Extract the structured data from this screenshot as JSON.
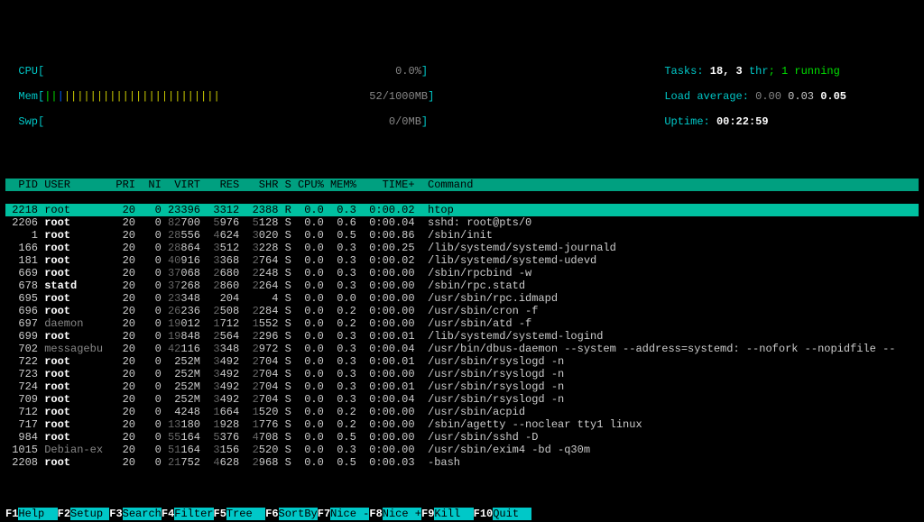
{
  "meters": {
    "cpu_label": "CPU",
    "mem_label": "Mem",
    "swp_label": "Swp",
    "cpu_value": "0.0%",
    "mem_value": "52/1000MB",
    "swp_value": "0/0MB",
    "tasks_label": "Tasks: ",
    "tasks_value": "18, 3 ",
    "tasks_thr": "thr",
    "tasks_running": "; 1 running",
    "load_label": "Load average: ",
    "load1": "0.00",
    "load2": "0.03",
    "load3": "0.05",
    "uptime_label": "Uptime: ",
    "uptime_value": "00:22:59"
  },
  "header": {
    "pid": "PID",
    "user": "USER",
    "pri": "PRI",
    "ni": "NI",
    "virt": "VIRT",
    "res": "RES",
    "shr": "SHR",
    "s": "S",
    "cpu": "CPU%",
    "mem": "MEM%",
    "time": "TIME+",
    "cmd": "Command"
  },
  "processes": [
    {
      "pid": "2218",
      "user": "root",
      "pri": "20",
      "ni": "0",
      "virt": "23396",
      "res": "3312",
      "shr": "2388",
      "s": "R",
      "cpu": "0.0",
      "mem": "0.3",
      "time": "0:00.02",
      "cmd": "htop",
      "selected": true
    },
    {
      "pid": "2206",
      "user": "root",
      "pri": "20",
      "ni": "0",
      "virt": "82700",
      "res": "5976",
      "shr": "5128",
      "s": "S",
      "cpu": "0.0",
      "mem": "0.6",
      "time": "0:00.04",
      "cmd": "sshd: root@pts/0"
    },
    {
      "pid": "1",
      "user": "root",
      "pri": "20",
      "ni": "0",
      "virt": "28556",
      "res": "4624",
      "shr": "3020",
      "s": "S",
      "cpu": "0.0",
      "mem": "0.5",
      "time": "0:00.86",
      "cmd": "/sbin/init"
    },
    {
      "pid": "166",
      "user": "root",
      "pri": "20",
      "ni": "0",
      "virt": "28864",
      "res": "3512",
      "shr": "3228",
      "s": "S",
      "cpu": "0.0",
      "mem": "0.3",
      "time": "0:00.25",
      "cmd": "/lib/systemd/systemd-journald"
    },
    {
      "pid": "181",
      "user": "root",
      "pri": "20",
      "ni": "0",
      "virt": "40916",
      "res": "3368",
      "shr": "2764",
      "s": "S",
      "cpu": "0.0",
      "mem": "0.3",
      "time": "0:00.02",
      "cmd": "/lib/systemd/systemd-udevd"
    },
    {
      "pid": "669",
      "user": "root",
      "pri": "20",
      "ni": "0",
      "virt": "37068",
      "res": "2680",
      "shr": "2248",
      "s": "S",
      "cpu": "0.0",
      "mem": "0.3",
      "time": "0:00.00",
      "cmd": "/sbin/rpcbind -w"
    },
    {
      "pid": "678",
      "user": "statd",
      "pri": "20",
      "ni": "0",
      "virt": "37268",
      "res": "2860",
      "shr": "2264",
      "s": "S",
      "cpu": "0.0",
      "mem": "0.3",
      "time": "0:00.00",
      "cmd": "/sbin/rpc.statd"
    },
    {
      "pid": "695",
      "user": "root",
      "pri": "20",
      "ni": "0",
      "virt": "23348",
      "res": "204",
      "shr": "4",
      "s": "S",
      "cpu": "0.0",
      "mem": "0.0",
      "time": "0:00.00",
      "cmd": "/usr/sbin/rpc.idmapd"
    },
    {
      "pid": "696",
      "user": "root",
      "pri": "20",
      "ni": "0",
      "virt": "26236",
      "res": "2508",
      "shr": "2284",
      "s": "S",
      "cpu": "0.0",
      "mem": "0.2",
      "time": "0:00.00",
      "cmd": "/usr/sbin/cron -f"
    },
    {
      "pid": "697",
      "user": "daemon",
      "pri": "20",
      "ni": "0",
      "virt": "19012",
      "res": "1712",
      "shr": "1552",
      "s": "S",
      "cpu": "0.0",
      "mem": "0.2",
      "time": "0:00.00",
      "cmd": "/usr/sbin/atd -f",
      "dim": true
    },
    {
      "pid": "699",
      "user": "root",
      "pri": "20",
      "ni": "0",
      "virt": "19848",
      "res": "2564",
      "shr": "2296",
      "s": "S",
      "cpu": "0.0",
      "mem": "0.3",
      "time": "0:00.01",
      "cmd": "/lib/systemd/systemd-logind"
    },
    {
      "pid": "702",
      "user": "messagebu",
      "pri": "20",
      "ni": "0",
      "virt": "42116",
      "res": "3348",
      "shr": "2972",
      "s": "S",
      "cpu": "0.0",
      "mem": "0.3",
      "time": "0:00.04",
      "cmd": "/usr/bin/dbus-daemon --system --address=systemd: --nofork --nopidfile --",
      "dim": true
    },
    {
      "pid": "722",
      "user": "root",
      "pri": "20",
      "ni": "0",
      "virt": "252M",
      "res": "3492",
      "shr": "2704",
      "s": "S",
      "cpu": "0.0",
      "mem": "0.3",
      "time": "0:00.01",
      "cmd": "/usr/sbin/rsyslogd -n"
    },
    {
      "pid": "723",
      "user": "root",
      "pri": "20",
      "ni": "0",
      "virt": "252M",
      "res": "3492",
      "shr": "2704",
      "s": "S",
      "cpu": "0.0",
      "mem": "0.3",
      "time": "0:00.00",
      "cmd": "/usr/sbin/rsyslogd -n"
    },
    {
      "pid": "724",
      "user": "root",
      "pri": "20",
      "ni": "0",
      "virt": "252M",
      "res": "3492",
      "shr": "2704",
      "s": "S",
      "cpu": "0.0",
      "mem": "0.3",
      "time": "0:00.01",
      "cmd": "/usr/sbin/rsyslogd -n"
    },
    {
      "pid": "709",
      "user": "root",
      "pri": "20",
      "ni": "0",
      "virt": "252M",
      "res": "3492",
      "shr": "2704",
      "s": "S",
      "cpu": "0.0",
      "mem": "0.3",
      "time": "0:00.04",
      "cmd": "/usr/sbin/rsyslogd -n"
    },
    {
      "pid": "712",
      "user": "root",
      "pri": "20",
      "ni": "0",
      "virt": "4248",
      "res": "1664",
      "shr": "1520",
      "s": "S",
      "cpu": "0.0",
      "mem": "0.2",
      "time": "0:00.00",
      "cmd": "/usr/sbin/acpid"
    },
    {
      "pid": "717",
      "user": "root",
      "pri": "20",
      "ni": "0",
      "virt": "13180",
      "res": "1928",
      "shr": "1776",
      "s": "S",
      "cpu": "0.0",
      "mem": "0.2",
      "time": "0:00.00",
      "cmd": "/sbin/agetty --noclear tty1 linux"
    },
    {
      "pid": "984",
      "user": "root",
      "pri": "20",
      "ni": "0",
      "virt": "55164",
      "res": "5376",
      "shr": "4708",
      "s": "S",
      "cpu": "0.0",
      "mem": "0.5",
      "time": "0:00.00",
      "cmd": "/usr/sbin/sshd -D"
    },
    {
      "pid": "1015",
      "user": "Debian-ex",
      "pri": "20",
      "ni": "0",
      "virt": "51164",
      "res": "3156",
      "shr": "2520",
      "s": "S",
      "cpu": "0.0",
      "mem": "0.3",
      "time": "0:00.00",
      "cmd": "/usr/sbin/exim4 -bd -q30m",
      "dim": true
    },
    {
      "pid": "2208",
      "user": "root",
      "pri": "20",
      "ni": "0",
      "virt": "21752",
      "res": "4628",
      "shr": "2968",
      "s": "S",
      "cpu": "0.0",
      "mem": "0.5",
      "time": "0:00.03",
      "cmd": "-bash"
    }
  ],
  "footer": [
    {
      "key": "F1",
      "label": "Help  "
    },
    {
      "key": "F2",
      "label": "Setup "
    },
    {
      "key": "F3",
      "label": "Search"
    },
    {
      "key": "F4",
      "label": "Filter"
    },
    {
      "key": "F5",
      "label": "Tree  "
    },
    {
      "key": "F6",
      "label": "SortBy"
    },
    {
      "key": "F7",
      "label": "Nice -"
    },
    {
      "key": "F8",
      "label": "Nice +"
    },
    {
      "key": "F9",
      "label": "Kill  "
    },
    {
      "key": "F10",
      "label": "Quit  "
    }
  ]
}
